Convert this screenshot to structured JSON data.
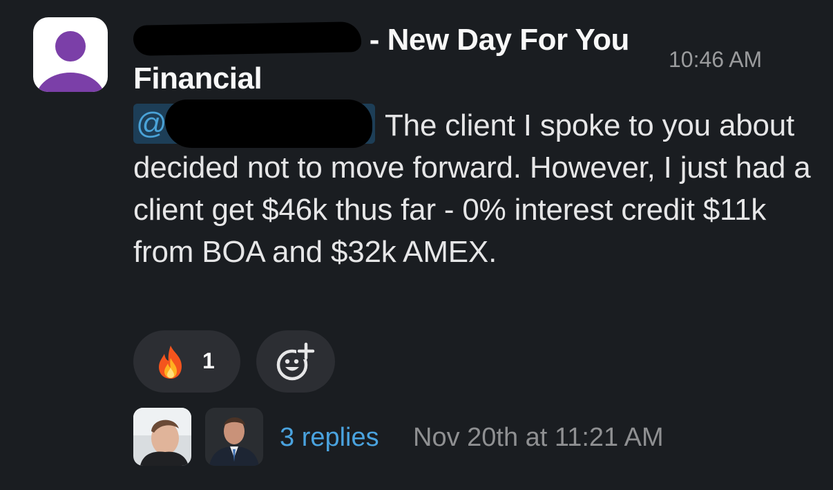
{
  "message": {
    "sender_suffix": " - New Day For You",
    "sender_line2": "Financial",
    "timestamp": "10:46 AM",
    "mention_at": "@",
    "body_text": "The client I spoke to you about decided not to move forward. However, I just had a client get $46k thus far - 0% interest credit $11k from BOA and $32k AMEX."
  },
  "reactions": [
    {
      "emoji_icon": "fire-icon",
      "count": "1"
    }
  ],
  "add_reaction_icon": "add-reaction-icon",
  "thread": {
    "replies_label": "3 replies",
    "last_reply": "Nov 20th at 11:21 AM"
  },
  "colors": {
    "background": "#1a1d21",
    "link": "#4aa3df",
    "mention_bg": "#1d3e57",
    "avatar_purple": "#7b3fa8"
  }
}
